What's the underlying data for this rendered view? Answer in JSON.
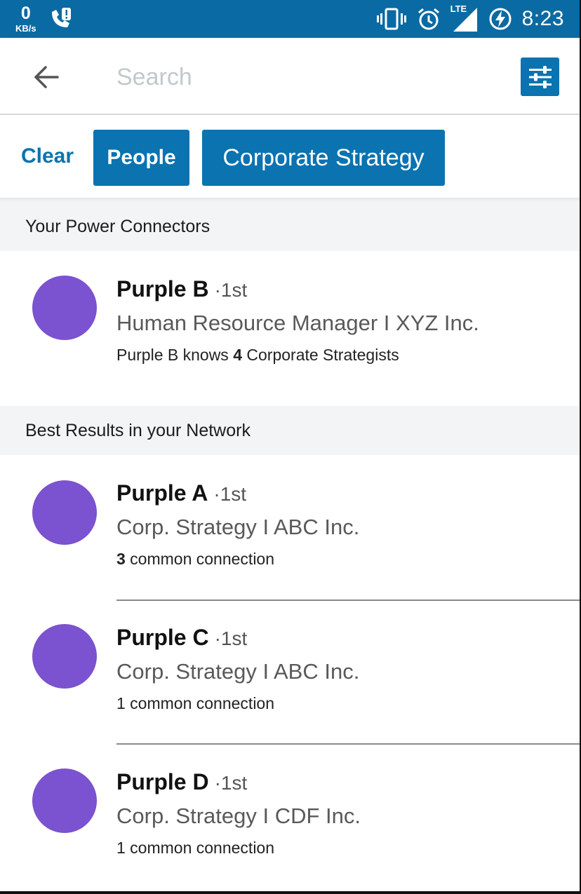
{
  "status_bar": {
    "speed_value": "0",
    "speed_unit": "KB/s",
    "network_label": "LTE",
    "time": "8:23",
    "icons": [
      "missed-call-icon",
      "vibrate-icon",
      "alarm-icon",
      "signal-icon",
      "battery-charging-icon"
    ]
  },
  "search": {
    "placeholder": "Search"
  },
  "filters": {
    "clear_label": "Clear",
    "chips": [
      "People",
      "Corporate Strategy"
    ]
  },
  "sections": {
    "power_connectors": {
      "title": "Your Power Connectors",
      "results": [
        {
          "name": "Purple B",
          "degree": "·1st",
          "headline": "Human Resource Manager I XYZ Inc.",
          "sub_prefix": "Purple B knows ",
          "sub_count": "4",
          "sub_suffix": " Corporate Strategists"
        }
      ]
    },
    "best_results": {
      "title": "Best Results in your Network",
      "results": [
        {
          "name": "Purple A",
          "degree": "·1st",
          "headline": "Corp. Strategy I ABC Inc.",
          "sub_count": "3",
          "sub_suffix": " common connection"
        },
        {
          "name": "Purple C",
          "degree": "·1st",
          "headline": "Corp. Strategy I ABC Inc.",
          "sub_text": "1 common connection"
        },
        {
          "name": "Purple D",
          "degree": "·1st",
          "headline": "Corp. Strategy I CDF Inc.",
          "sub_text": "1 common connection"
        }
      ]
    }
  },
  "colors": {
    "brand_blue": "#0a73b0",
    "status_bar": "#0a6aa3",
    "avatar_purple": "#7b52cf",
    "section_bg": "#f2f4f5"
  }
}
